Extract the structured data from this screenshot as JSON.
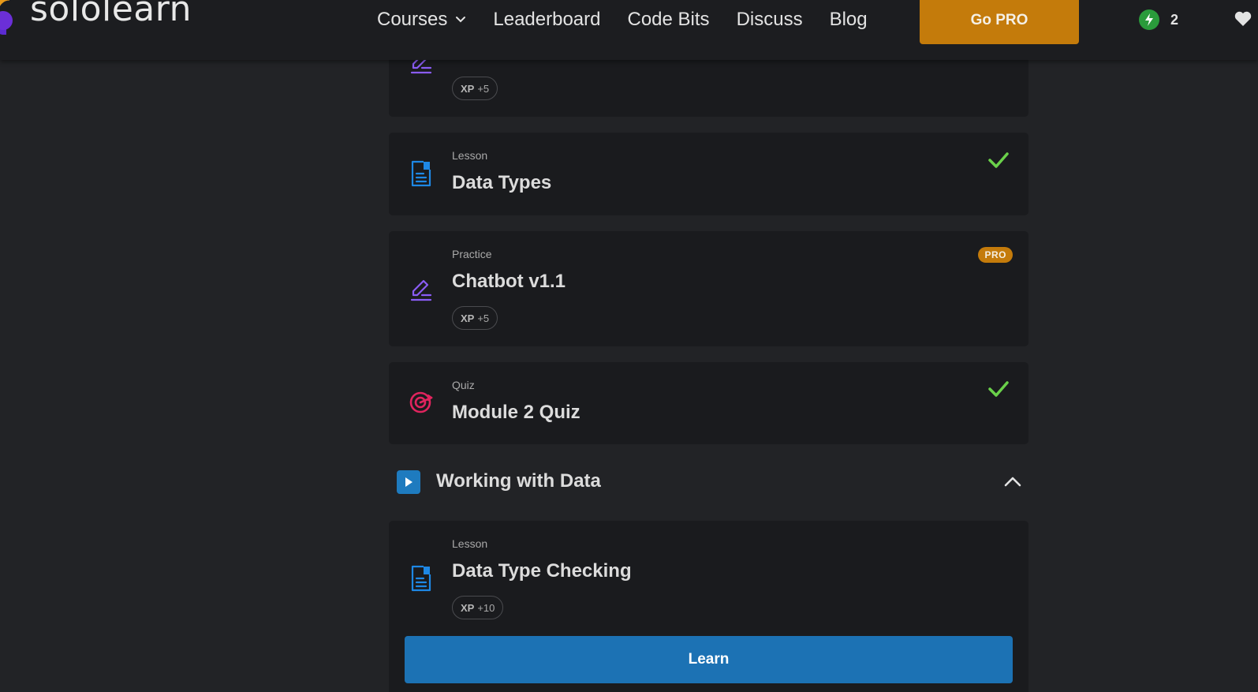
{
  "nav": {
    "logo_text": "sololearn",
    "items": [
      {
        "label": "Courses",
        "has_dropdown": true
      },
      {
        "label": "Leaderboard"
      },
      {
        "label": "Code Bits"
      },
      {
        "label": "Discuss"
      },
      {
        "label": "Blog"
      }
    ],
    "gopro_label": "Go PRO",
    "streak_count": "2",
    "streak_icon": "lightning-icon",
    "heart_icon": "heart-icon"
  },
  "colors": {
    "accent_pro": "#c47b0b",
    "learn_blue": "#1c72b4",
    "check_green": "#6ad14a",
    "lesson_icon": "#1e88e5",
    "practice_icon": "#8a5cf5",
    "quiz_icon": "#e0245e"
  },
  "cards": [
    {
      "title": "",
      "xp_label": "XP",
      "xp_value": "+5",
      "icon": "pencil-icon"
    },
    {
      "type": "Lesson",
      "title": "Data Types",
      "icon": "document-icon",
      "completed": true
    },
    {
      "type": "Practice",
      "title": "Chatbot v1.1",
      "badge": "PRO",
      "xp_label": "XP",
      "xp_value": "+5",
      "icon": "pencil-icon"
    },
    {
      "type": "Quiz",
      "title": "Module 2 Quiz",
      "icon": "target-icon",
      "completed": true
    }
  ],
  "module": {
    "title": "Working with Data",
    "icon": "play-icon",
    "expanded": true
  },
  "module_cards": [
    {
      "type": "Lesson",
      "title": "Data Type Checking",
      "xp_label": "XP",
      "xp_value": "+10",
      "icon": "document-icon",
      "action_label": "Learn"
    }
  ]
}
